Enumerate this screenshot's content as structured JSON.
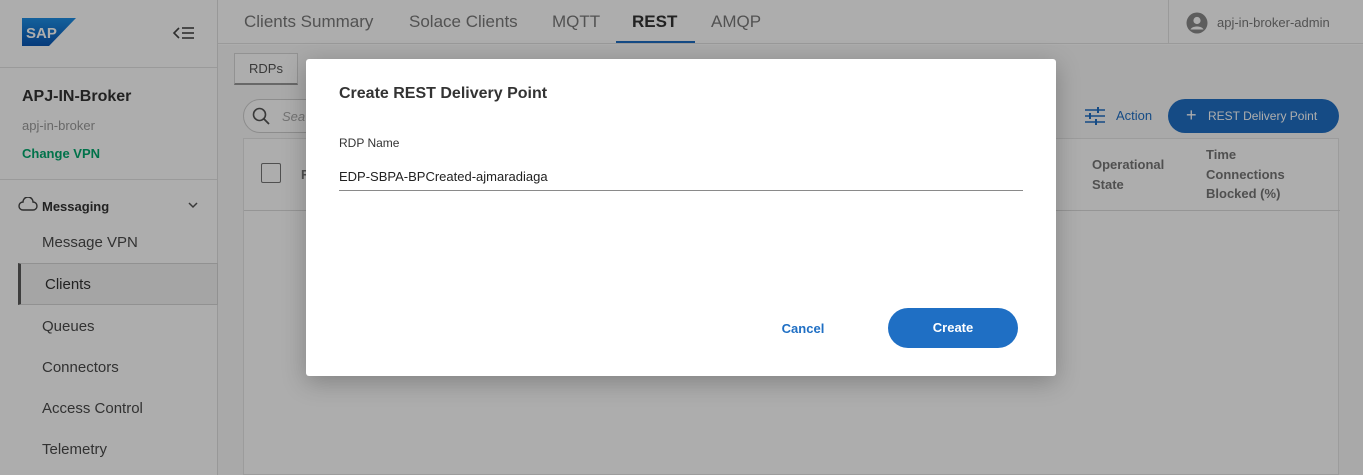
{
  "brand": {
    "logo_text": "SAP"
  },
  "sidebar": {
    "broker_name": "APJ-IN-Broker",
    "broker_id": "apj-in-broker",
    "change_vpn": "Change VPN",
    "section": {
      "label": "Messaging",
      "icon": "cloud-icon"
    },
    "items": [
      {
        "label": "Message VPN"
      },
      {
        "label": "Clients"
      },
      {
        "label": "Queues"
      },
      {
        "label": "Connectors"
      },
      {
        "label": "Access Control"
      },
      {
        "label": "Telemetry"
      }
    ]
  },
  "topbar": {
    "tabs": [
      {
        "label": "Clients Summary"
      },
      {
        "label": "Solace Clients"
      },
      {
        "label": "MQTT"
      },
      {
        "label": "REST"
      },
      {
        "label": "AMQP"
      }
    ],
    "active_tab": "REST",
    "user": "apj-in-broker-admin"
  },
  "main": {
    "subtab": "RDPs",
    "search_placeholder": "Sea",
    "action_label": "Action",
    "add_button_label": "REST Delivery Point",
    "table": {
      "col_name": "R",
      "col_operational_state": "Operational State",
      "col_time_connections_blocked": "Time Connections Blocked (%)"
    }
  },
  "dialog": {
    "title": "Create REST Delivery Point",
    "field_label": "RDP Name",
    "field_value": "EDP-SBPA-BPCreated-ajmaradiaga",
    "cancel_label": "Cancel",
    "create_label": "Create"
  },
  "colors": {
    "accent": "#1f6fc4",
    "change_vpn": "#00a96e",
    "sap_logo": "#0a6ed1"
  }
}
